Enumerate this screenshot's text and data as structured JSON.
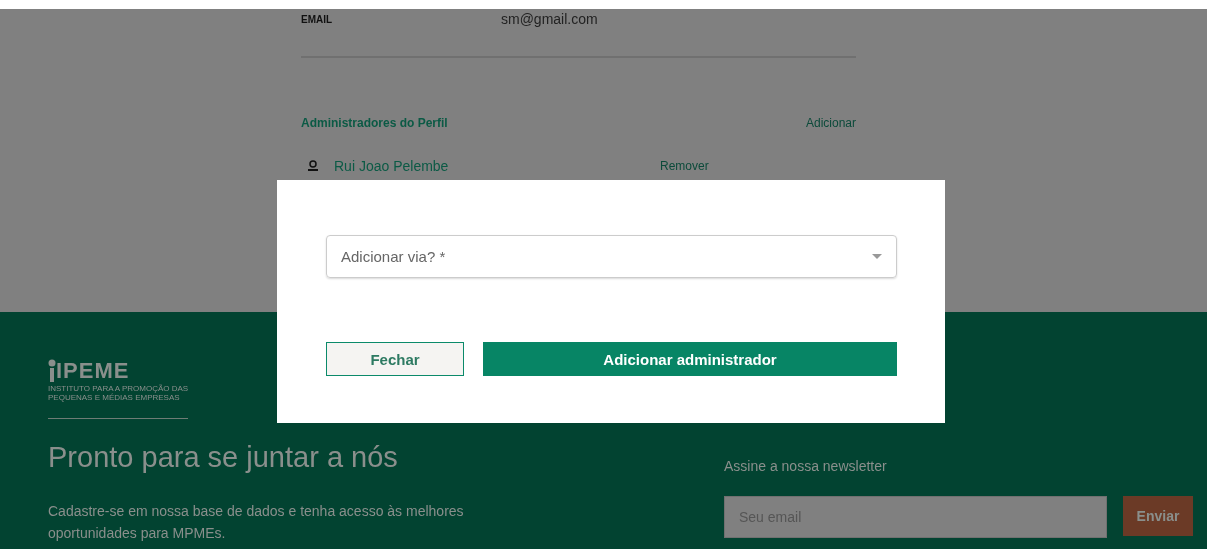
{
  "profile": {
    "email_label": "EMAIL",
    "email_value": "sm@gmail.com",
    "admins_title": "Administradores do Perfil",
    "add_link": "Adicionar",
    "admins": [
      {
        "name": "Rui Joao Pelembe",
        "action": "Remover"
      }
    ]
  },
  "modal": {
    "select": {
      "placeholder": "Adicionar via? *"
    },
    "close_button": "Fechar",
    "submit_button": "Adicionar administrador"
  },
  "footer": {
    "logo": {
      "name": "IPEME",
      "subtitle_1": "INSTITUTO PARA A PROMOÇÃO DAS",
      "subtitle_2": "PEQUENAS E MÉDIAS EMPRESAS"
    },
    "heading": "Pronto para se juntar a nós",
    "text": "Cadastre-se em nossa base de dados e tenha acesso às melhores oportunidades para MPMEs.",
    "newsletter": {
      "title": "Assine a nossa newsletter",
      "placeholder": "Seu email",
      "button": "Enviar"
    }
  }
}
